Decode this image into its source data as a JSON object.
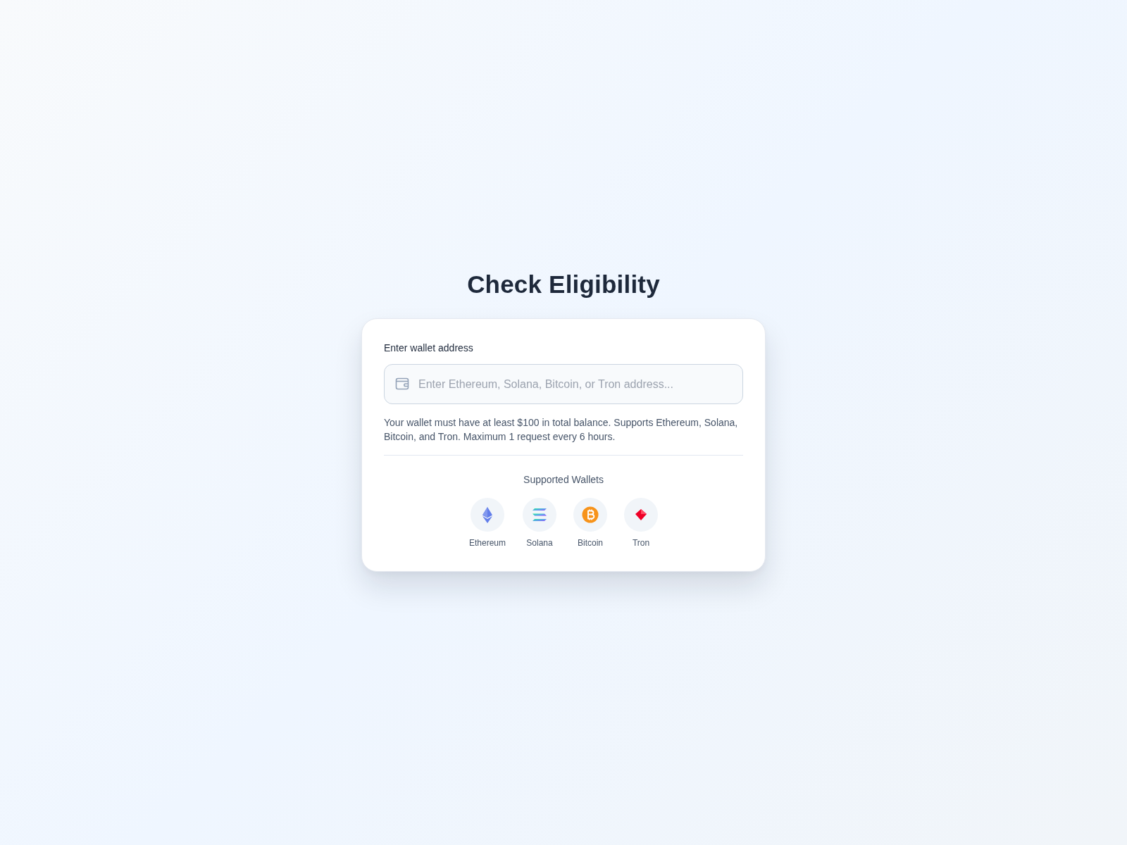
{
  "title": "Check Eligibility",
  "form": {
    "label": "Enter wallet address",
    "input": {
      "placeholder": "Enter Ethereum, Solana, Bitcoin, or Tron address..."
    },
    "help_text": "Your wallet must have at least $100 in total balance. Supports Ethereum, Solana, Bitcoin, and Tron. Maximum 1 request every 6 hours."
  },
  "supported_wallets": {
    "heading": "Supported Wallets",
    "items": [
      {
        "name": "Ethereum",
        "kind": "ethereum"
      },
      {
        "name": "Solana",
        "kind": "solana"
      },
      {
        "name": "Bitcoin",
        "kind": "bitcoin"
      },
      {
        "name": "Tron",
        "kind": "tron"
      }
    ]
  }
}
